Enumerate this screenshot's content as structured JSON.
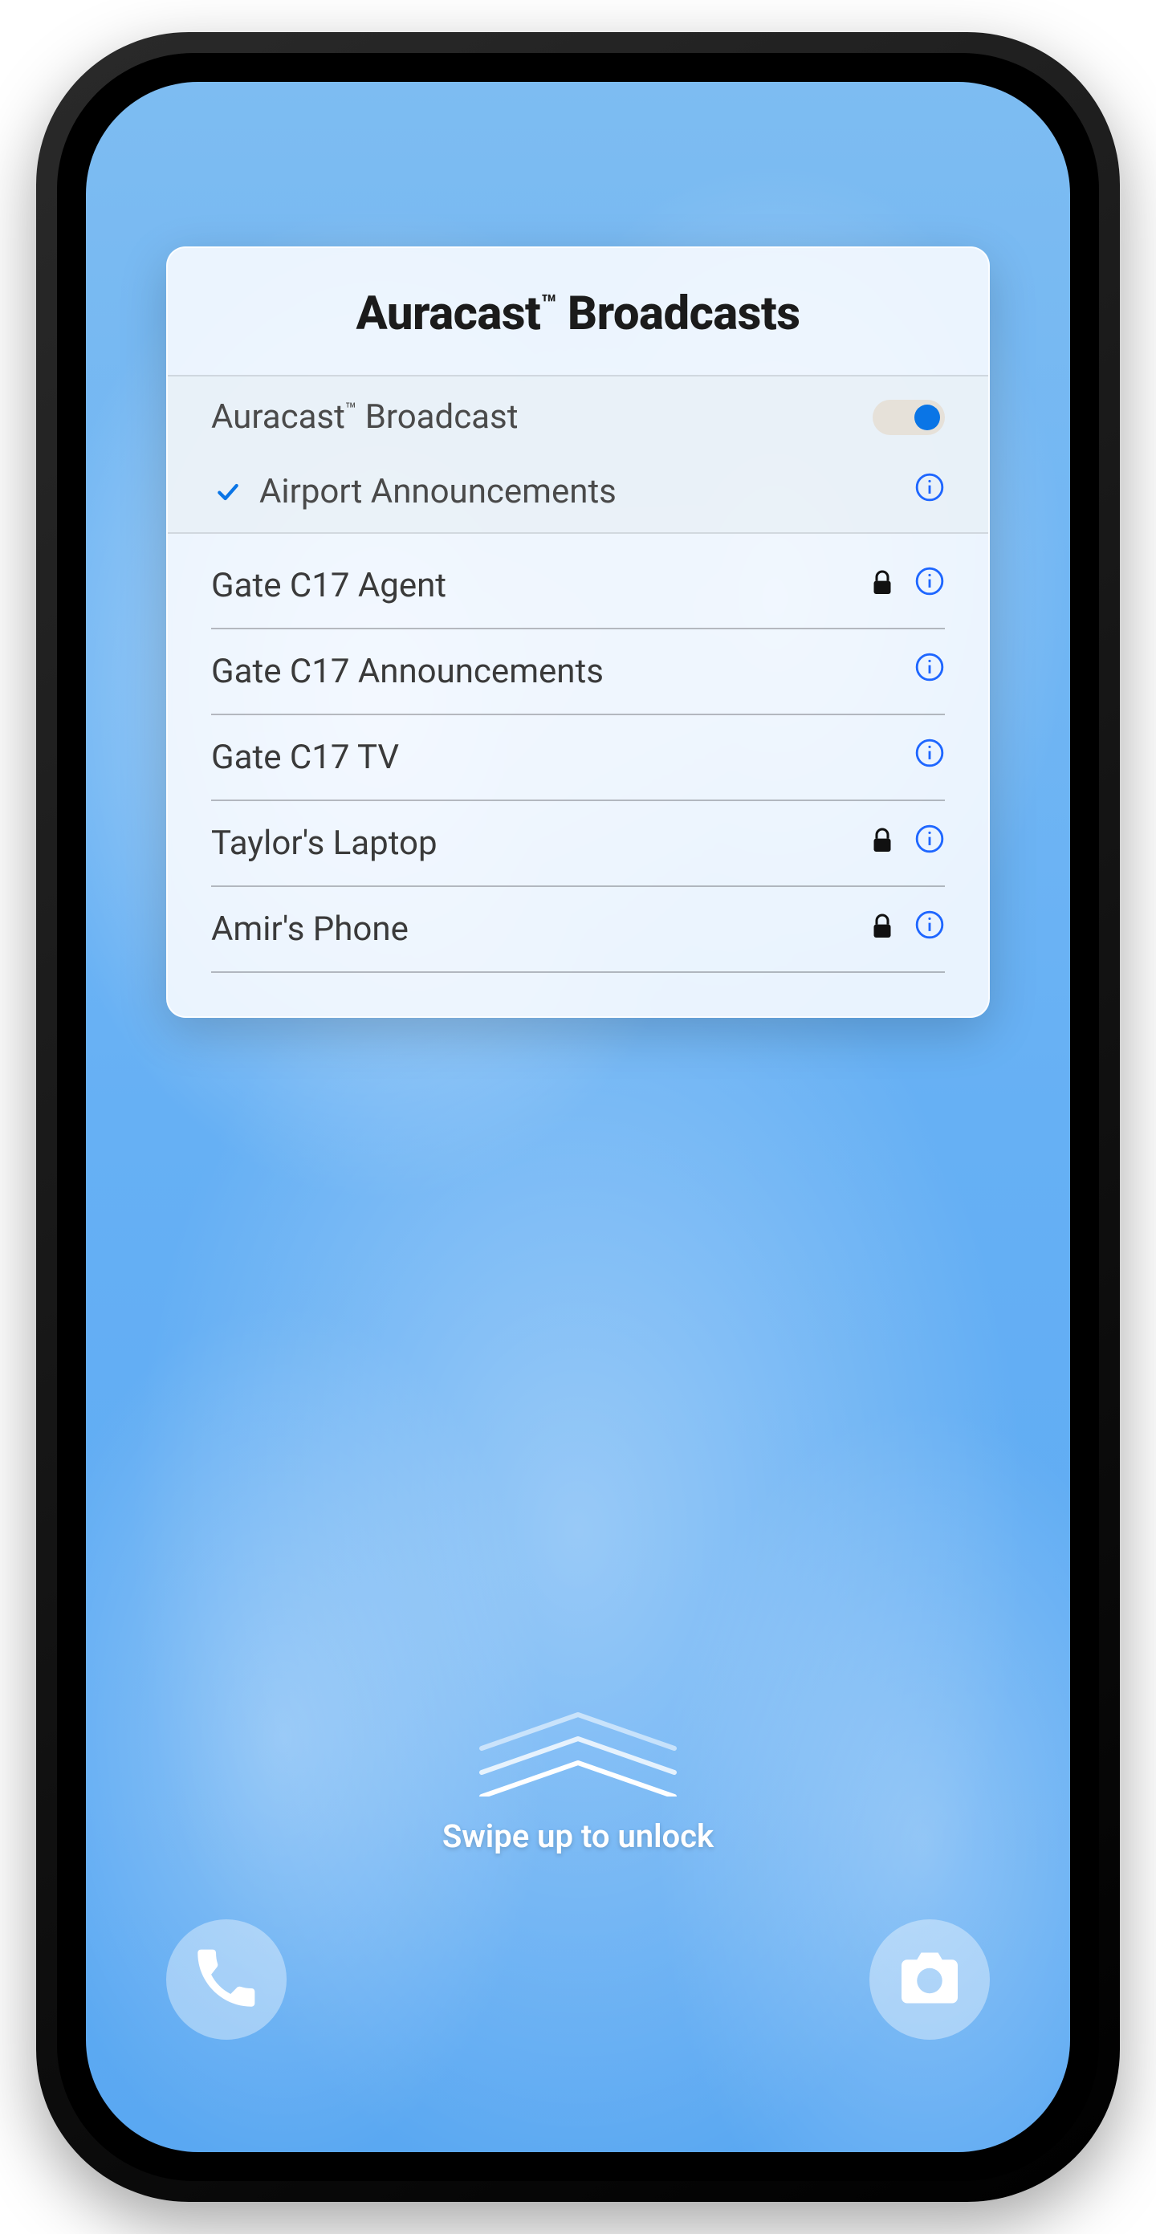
{
  "card": {
    "title_prefix": "Auracast",
    "title_tm": "™",
    "title_suffix": " Broadcasts",
    "toggle_row": {
      "label_prefix": "Auracast",
      "label_tm": "™",
      "label_suffix": " Broadcast",
      "enabled": true
    },
    "connected_row": {
      "label": "Airport Announcements",
      "checked": true,
      "has_info": true
    },
    "available": [
      {
        "name": "Gate C17 Agent",
        "locked": true,
        "has_info": true
      },
      {
        "name": "Gate C17 Announcements",
        "locked": false,
        "has_info": true
      },
      {
        "name": "Gate C17 TV",
        "locked": false,
        "has_info": true
      },
      {
        "name": "Taylor's Laptop",
        "locked": true,
        "has_info": true
      },
      {
        "name": "Amir's Phone",
        "locked": true,
        "has_info": true
      }
    ]
  },
  "lockscreen": {
    "swipe_text": "Swipe up to unlock"
  },
  "colors": {
    "accent_blue": "#0a75e6",
    "info_blue": "#1e66ff"
  }
}
